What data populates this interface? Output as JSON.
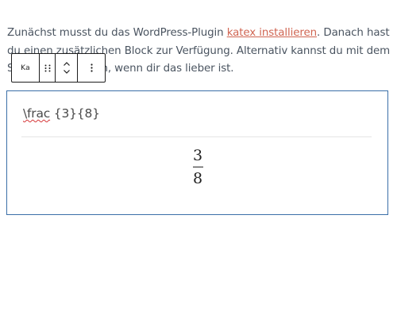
{
  "paragraph": {
    "text_before": "Zunächst musst du das WordPress-Plugin ",
    "link": "katex installieren",
    "text_line1_end": ". Danach hast du einen zusätzlichen Block zur Verfügung. Alternativ kannst d",
    "text_hidden": "u mit de",
    "text_after": "m Shortcode arbeiten, wenn dir das lieber ist."
  },
  "toolbar": {
    "block_type": "Ka",
    "drag_icon": "drag-handle-icon",
    "move_up_icon": "chevron-up-icon",
    "move_down_icon": "chevron-down-icon",
    "more_icon": "more-vertical-icon"
  },
  "katex_block": {
    "source_cmd": "\\frac",
    "source_args": " {3}{8}",
    "numerator": "3",
    "denominator": "8"
  },
  "colors": {
    "link": "#d06552",
    "block_border": "#3b6fa8",
    "spellcheck": "#d63638"
  }
}
